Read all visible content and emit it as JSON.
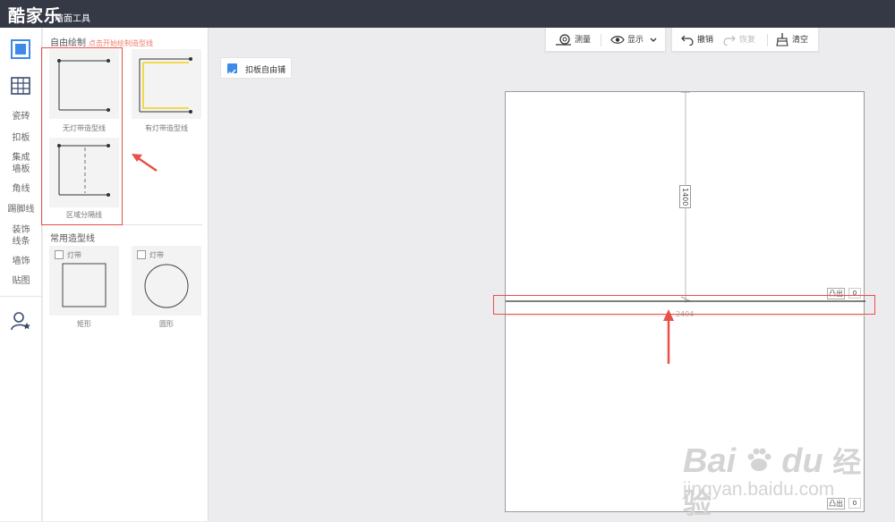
{
  "app": {
    "logo": "酷家乐",
    "subtitle": "墙面工具"
  },
  "sidebar": {
    "items": [
      {
        "label": "瓷砖"
      },
      {
        "label": "扣板"
      },
      {
        "label": "集成墙板"
      },
      {
        "label": "角线"
      },
      {
        "label": "踢脚线"
      },
      {
        "label": "装饰线条"
      },
      {
        "label": "墙饰"
      },
      {
        "label": "贴图"
      }
    ]
  },
  "panel": {
    "free_draw_title": "自由绘制",
    "free_draw_hint": "点击开始绘制造型线",
    "tiles": [
      {
        "label": "无灯带造型线"
      },
      {
        "label": "有灯带造型线"
      },
      {
        "label": "区域分隔线"
      }
    ],
    "common_title": "常用造型线",
    "shapes": [
      {
        "checkbox_label": "灯带",
        "label": "矩形"
      },
      {
        "checkbox_label": "灯带",
        "label": "圆形"
      }
    ]
  },
  "toolbar": {
    "measure": "测量",
    "display": "显示",
    "undo": "撤销",
    "redo": "恢复",
    "clear": "清空"
  },
  "canvas": {
    "free_tile_label": "扣板自由铺",
    "dim_vertical": "1400",
    "dim_horizontal": "2404",
    "tag_label": "凸出",
    "tag_value_1": "0",
    "tag_value_2": "0"
  },
  "watermark": {
    "line1": "Bai",
    "line1b": "du",
    "line1c": "经验",
    "line2": "jingyan.baidu.com"
  },
  "colors": {
    "accent": "#3e8ae6",
    "highlight": "#e8504a",
    "topbar": "#353945"
  }
}
